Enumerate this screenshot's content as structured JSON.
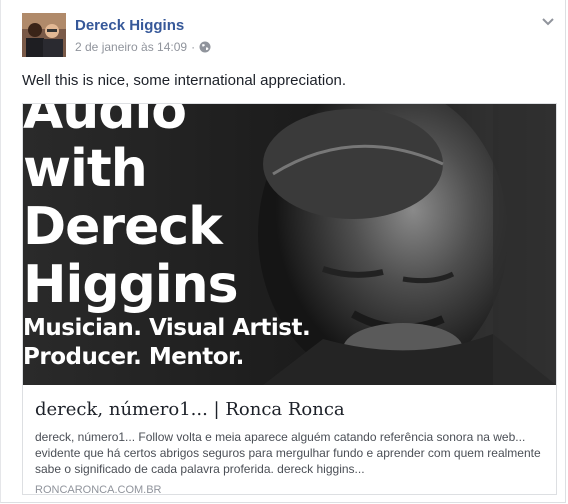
{
  "post": {
    "author": "Dereck Higgins",
    "timestamp": "2 de janeiro às 14:09",
    "separator": "·",
    "privacy_icon": "globe-icon",
    "options_icon": "chevron-down-icon",
    "message": "Well this is nice, some international appreciation."
  },
  "share": {
    "image_text": {
      "line1": "Audio",
      "line2": "with",
      "line3": "Dereck",
      "line4": "Higgins",
      "line5": "Musician. Visual Artist.",
      "line6": "Producer. Mentor."
    },
    "title": "dereck, número1... | Ronca Ronca",
    "description": "dereck, número1... Follow volta e meia aparece alguém catando referência sonora na web... evidente que há certos abrigos seguros para mergulhar fundo e aprender com quem realmente sabe o significado de cada palavra proferida. dereck higgins...",
    "domain": "RONCARONCA.COM.BR"
  },
  "colors": {
    "author_link": "#365899",
    "meta_text": "#90949c",
    "body_text": "#1d2129",
    "border": "#dddfe2"
  }
}
